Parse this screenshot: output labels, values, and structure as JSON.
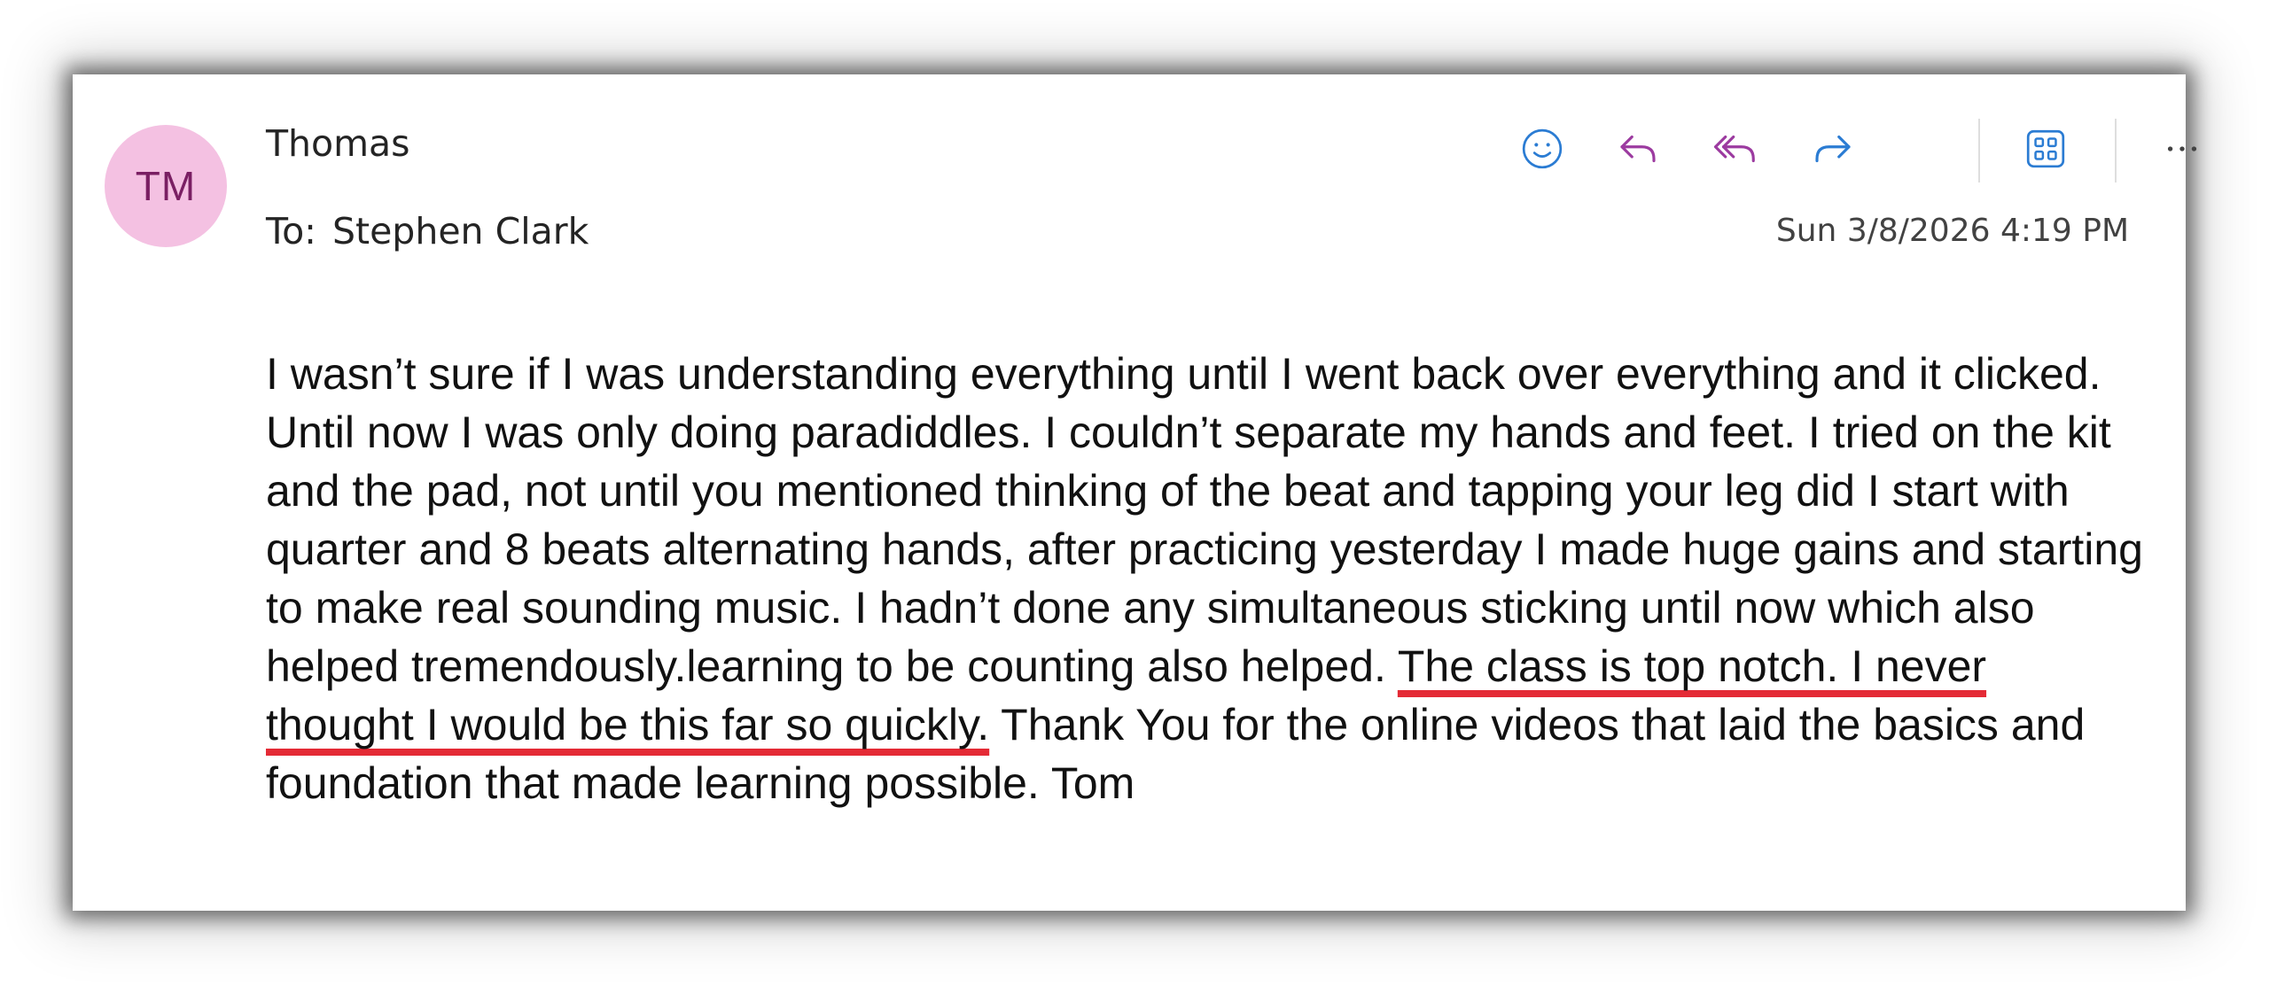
{
  "email": {
    "avatar_initials": "TM",
    "avatar_color": "#f4c1e2",
    "sender": "Thomas",
    "to_label": "To:",
    "recipient": "Stephen Clark",
    "date": "Sun 3/8/2026 4:19 PM",
    "body_before_highlight": "I wasn’t sure if I was understanding everything until I went back over everything and it clicked. Until now I was only doing paradiddles. I couldn’t separate my hands and feet. I tried on the kit and the pad, not until you mentioned thinking of the beat and tapping your leg did I start with quarter and 8 beats alternating hands, after practicing yesterday I made huge gains and starting to make real sounding music. I hadn’t done any simultaneous sticking until now which also helped tremendously.learning to be counting also helped. ",
    "body_highlight": "The class is top notch. I never thought I would be this far so quickly.",
    "body_after_highlight": " Thank You for the online videos that laid the basics and foundation that made learning possible. Tom",
    "highlight_color": "#e42a35"
  },
  "toolbar": {
    "icons": [
      "emoji-icon",
      "reply-icon",
      "reply-all-icon",
      "forward-icon",
      "apps-icon",
      "more-icon"
    ],
    "emoji_color": "#2b7cd3",
    "reply_color": "#9c3ba0",
    "forward_color": "#2b7cd3",
    "apps_color": "#2b7cd3"
  }
}
